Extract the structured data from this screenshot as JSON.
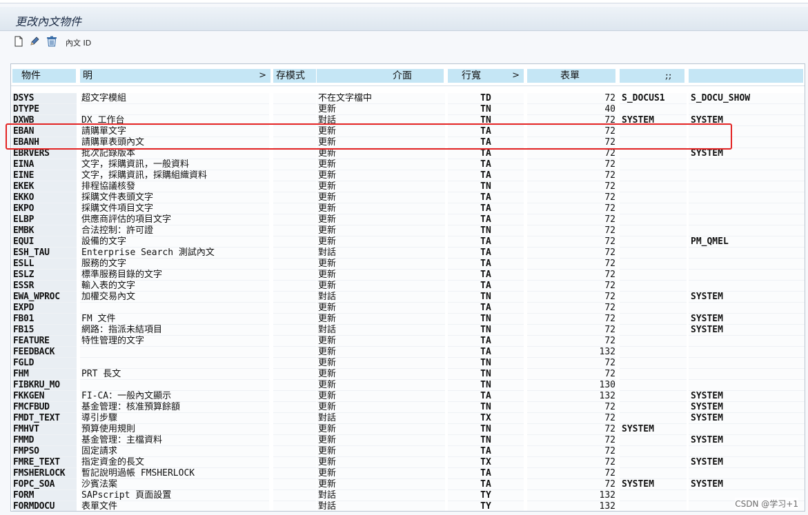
{
  "title": "更改內文物件",
  "toolbar": {
    "text_id_label": "內文 ID"
  },
  "columns": [
    {
      "label": "物件"
    },
    {
      "label": "明",
      "arrow": ">"
    },
    {
      "label": "存模式"
    },
    {
      "label": "介面"
    },
    {
      "label": "行寬",
      "arrow": ">"
    },
    {
      "label": "表單"
    },
    {
      "label": ";;"
    },
    {
      "label": ""
    }
  ],
  "rows": [
    {
      "obj": "DSYS",
      "desc": "超文字模組",
      "save": "",
      "iface": "不在文字檔中",
      "line": "TD",
      "form": "72",
      "s1": "S_DOCUS1",
      "s2": "S_DOCU_SHOW"
    },
    {
      "obj": "DTYPE",
      "desc": "",
      "save": "",
      "iface": "更新",
      "line": "TN",
      "form": "40",
      "s1": "",
      "s2": ""
    },
    {
      "obj": "DXWB",
      "desc": "DX 工作台",
      "save": "",
      "iface": "對話",
      "line": "TN",
      "form": "72",
      "s1": "SYSTEM",
      "s2": "SYSTEM"
    },
    {
      "obj": "EBAN",
      "desc": "請購單文字",
      "save": "",
      "iface": "更新",
      "line": "TA",
      "form": "72",
      "s1": "",
      "s2": ""
    },
    {
      "obj": "EBANH",
      "desc": "請購單表頭內文",
      "save": "",
      "iface": "更新",
      "line": "TA",
      "form": "72",
      "s1": "",
      "s2": ""
    },
    {
      "obj": "EBRVERS",
      "desc": "批次記錄版本",
      "save": "",
      "iface": "更新",
      "line": "TA",
      "form": "72",
      "s1": "",
      "s2": "SYSTEM"
    },
    {
      "obj": "EINA",
      "desc": "文字，採購資訊，一般資料",
      "save": "",
      "iface": "更新",
      "line": "TA",
      "form": "72",
      "s1": "",
      "s2": ""
    },
    {
      "obj": "EINE",
      "desc": "文字，採購資訊，採購組織資料",
      "save": "",
      "iface": "更新",
      "line": "TA",
      "form": "72",
      "s1": "",
      "s2": ""
    },
    {
      "obj": "EKEK",
      "desc": "排程協議核發",
      "save": "",
      "iface": "更新",
      "line": "TN",
      "form": "72",
      "s1": "",
      "s2": ""
    },
    {
      "obj": "EKKO",
      "desc": "採購文件表頭文字",
      "save": "",
      "iface": "更新",
      "line": "TA",
      "form": "72",
      "s1": "",
      "s2": ""
    },
    {
      "obj": "EKPO",
      "desc": "採購文件項目文字",
      "save": "",
      "iface": "更新",
      "line": "TA",
      "form": "72",
      "s1": "",
      "s2": ""
    },
    {
      "obj": "ELBP",
      "desc": "供應商評估的項目文字",
      "save": "",
      "iface": "更新",
      "line": "TA",
      "form": "72",
      "s1": "",
      "s2": ""
    },
    {
      "obj": "EMBK",
      "desc": "合法控制：許可證",
      "save": "",
      "iface": "更新",
      "line": "TN",
      "form": "72",
      "s1": "",
      "s2": ""
    },
    {
      "obj": "EQUI",
      "desc": "設備的文字",
      "save": "",
      "iface": "更新",
      "line": "TA",
      "form": "72",
      "s1": "",
      "s2": "PM_QMEL"
    },
    {
      "obj": "ESH_TAU",
      "desc": "Enterprise Search 測試內文",
      "save": "",
      "iface": "對話",
      "line": "TA",
      "form": "72",
      "s1": "",
      "s2": ""
    },
    {
      "obj": "ESLL",
      "desc": "服務的文字",
      "save": "",
      "iface": "更新",
      "line": "TA",
      "form": "72",
      "s1": "",
      "s2": ""
    },
    {
      "obj": "ESLZ",
      "desc": "標準服務目錄的文字",
      "save": "",
      "iface": "更新",
      "line": "TA",
      "form": "72",
      "s1": "",
      "s2": ""
    },
    {
      "obj": "ESSR",
      "desc": "輸入表的文字",
      "save": "",
      "iface": "更新",
      "line": "TA",
      "form": "72",
      "s1": "",
      "s2": ""
    },
    {
      "obj": "EWA_WPROC",
      "desc": "加權交易內文",
      "save": "",
      "iface": "對話",
      "line": "TN",
      "form": "72",
      "s1": "",
      "s2": "SYSTEM"
    },
    {
      "obj": "EXPD",
      "desc": "",
      "save": "",
      "iface": "更新",
      "line": "TA",
      "form": "72",
      "s1": "",
      "s2": ""
    },
    {
      "obj": "FB01",
      "desc": "FM 文件",
      "save": "",
      "iface": "更新",
      "line": "TN",
      "form": "72",
      "s1": "",
      "s2": "SYSTEM"
    },
    {
      "obj": "FB15",
      "desc": "網路：指派未結項目",
      "save": "",
      "iface": "對話",
      "line": "TN",
      "form": "72",
      "s1": "",
      "s2": "SYSTEM"
    },
    {
      "obj": "FEATURE",
      "desc": "特性管理的文字",
      "save": "",
      "iface": "更新",
      "line": "TA",
      "form": "72",
      "s1": "",
      "s2": ""
    },
    {
      "obj": "FEEDBACK",
      "desc": "",
      "save": "",
      "iface": "更新",
      "line": "TA",
      "form": "132",
      "s1": "",
      "s2": ""
    },
    {
      "obj": "FGLD",
      "desc": "",
      "save": "",
      "iface": "更新",
      "line": "TN",
      "form": "72",
      "s1": "",
      "s2": ""
    },
    {
      "obj": "FHM",
      "desc": "PRT 長文",
      "save": "",
      "iface": "更新",
      "line": "TN",
      "form": "72",
      "s1": "",
      "s2": ""
    },
    {
      "obj": "FIBKRU_MO",
      "desc": "",
      "save": "",
      "iface": "更新",
      "line": "TN",
      "form": "130",
      "s1": "",
      "s2": ""
    },
    {
      "obj": "FKKGEN",
      "desc": "FI-CA：一般內文顯示",
      "save": "",
      "iface": "更新",
      "line": "TA",
      "form": "132",
      "s1": "",
      "s2": "SYSTEM"
    },
    {
      "obj": "FMCFBUD",
      "desc": "基金管理：核准預算餘額",
      "save": "",
      "iface": "更新",
      "line": "TN",
      "form": "72",
      "s1": "",
      "s2": "SYSTEM"
    },
    {
      "obj": "FMDT_TEXT",
      "desc": "導引步驟",
      "save": "",
      "iface": "對話",
      "line": "TX",
      "form": "72",
      "s1": "",
      "s2": "SYSTEM"
    },
    {
      "obj": "FMHVT",
      "desc": "預算使用規則",
      "save": "",
      "iface": "更新",
      "line": "TN",
      "form": "72",
      "s1": "SYSTEM",
      "s2": ""
    },
    {
      "obj": "FMMD",
      "desc": "基金管理：主檔資料",
      "save": "",
      "iface": "更新",
      "line": "TN",
      "form": "72",
      "s1": "",
      "s2": "SYSTEM"
    },
    {
      "obj": "FMPSO",
      "desc": "固定請求",
      "save": "",
      "iface": "更新",
      "line": "TA",
      "form": "72",
      "s1": "",
      "s2": ""
    },
    {
      "obj": "FMRE_TEXT",
      "desc": "指定資金的長文",
      "save": "",
      "iface": "更新",
      "line": "TX",
      "form": "72",
      "s1": "",
      "s2": "SYSTEM"
    },
    {
      "obj": "FMSHERLOCK",
      "desc": "暫記說明過帳 FMSHERLOCK",
      "save": "",
      "iface": "更新",
      "line": "TA",
      "form": "72",
      "s1": "",
      "s2": ""
    },
    {
      "obj": "FOPC_SOA",
      "desc": "沙賓法案",
      "save": "",
      "iface": "更新",
      "line": "TA",
      "form": "72",
      "s1": "SYSTEM",
      "s2": "SYSTEM"
    },
    {
      "obj": "FORM",
      "desc": "SAPscript 頁面設置",
      "save": "",
      "iface": "對話",
      "line": "TY",
      "form": "132",
      "s1": "",
      "s2": ""
    },
    {
      "obj": "FORMDOCU",
      "desc": "表單文件",
      "save": "",
      "iface": "對話",
      "line": "TY",
      "form": "132",
      "s1": "",
      "s2": ""
    }
  ],
  "watermark": "CSDN @学习+1"
}
